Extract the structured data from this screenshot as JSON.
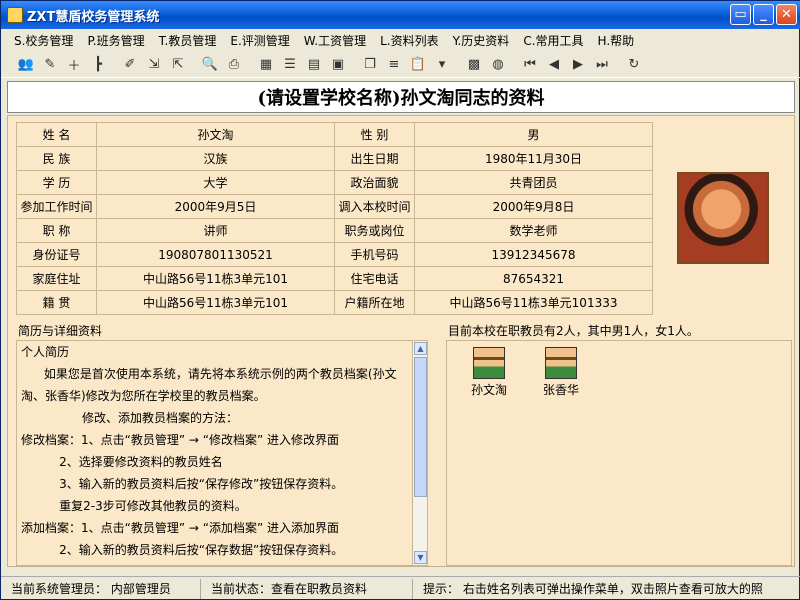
{
  "window": {
    "title": "ZXT慧盾校务管理系统"
  },
  "menu": [
    "S.校务管理",
    "P.班务管理",
    "T.教员管理",
    "E.评测管理",
    "W.工资管理",
    "L.资料列表",
    "Y.历史资料",
    "C.常用工具",
    "H.帮助"
  ],
  "header": {
    "title": "(请设置学校名称)孙文淘同志的资料"
  },
  "profile": {
    "rows": [
      {
        "l1": "姓    名",
        "v1": "孙文淘",
        "l2": "性    别",
        "v2": "男"
      },
      {
        "l1": "民    族",
        "v1": "汉族",
        "l2": "出生日期",
        "v2": "1980年11月30日"
      },
      {
        "l1": "学    历",
        "v1": "大学",
        "l2": "政治面貌",
        "v2": "共青团员"
      },
      {
        "l1": "参加工作时间",
        "v1": "2000年9月5日",
        "l2": "调入本校时间",
        "v2": "2000年9月8日"
      },
      {
        "l1": "职    称",
        "v1": "讲师",
        "l2": "职务或岗位",
        "v2": "数学老师"
      },
      {
        "l1": "身份证号",
        "v1": "190807801130521",
        "l2": "手机号码",
        "v2": "13912345678"
      },
      {
        "l1": "家庭住址",
        "v1": "中山路56号11栋3单元101",
        "l2": "住宅电话",
        "v2": "87654321"
      },
      {
        "l1": "籍    贯",
        "v1": "中山路56号11栋3单元101",
        "l2": "户籍所在地",
        "v2": "中山路56号11栋3单元101333"
      }
    ]
  },
  "resume": {
    "label": "简历与详细资料",
    "lines": [
      "个人简历",
      "      如果您是首次使用本系统，请先将本系统示例的两个教员档案(孙文",
      "淘、张香华)修改为您所在学校里的教员档案。",
      "                修改、添加教员档案的方法：",
      "修改档案：1、点击“教员管理” → “修改档案” 进入修改界面",
      "          2、选择要修改资料的教员姓名",
      "          3、输入新的教员资料后按“保存修改”按钮保存资料。",
      "          重复2-3步可修改其他教员的资料。",
      "添加档案：1、点击“教员管理” → “添加档案” 进入添加界面",
      "          2、输入新的教员资料后按“保存数据”按钮保存资料。"
    ]
  },
  "staff": {
    "summary": "目前本校在职教员有2人，其中男1人，女1人。",
    "members": [
      "孙文淘",
      "张香华"
    ]
  },
  "status": {
    "admin": "当前系统管理员：  内部管理员",
    "state": "当前状态：查看在职教员资料",
    "tip": "提示：  右击姓名列表可弹出操作菜单，双击照片查看可放大的照"
  }
}
